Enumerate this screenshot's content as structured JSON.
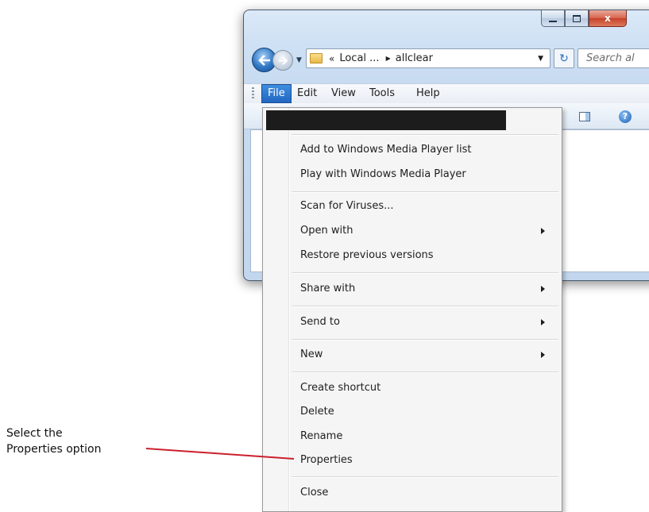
{
  "window": {
    "address": {
      "separator": "«",
      "crumb_local": "Local ...",
      "crumb_current": "allclear"
    },
    "search_placeholder": "Search al",
    "caption": {
      "close": "x"
    },
    "menubar": [
      "File",
      "Edit",
      "View",
      "Tools",
      "Help"
    ],
    "help_glyph": "?"
  },
  "file_menu": {
    "group1": [
      "Add to Windows Media Player list",
      "Play with Windows Media Player"
    ],
    "group2": [
      "Scan for Viruses...",
      "Open with",
      "Restore previous versions"
    ],
    "share_with": "Share with",
    "send_to": "Send to",
    "new": "New",
    "group3": [
      "Create shortcut",
      "Delete",
      "Rename",
      "Properties"
    ],
    "close": "Close"
  },
  "annotation": {
    "line1": "Select the",
    "line2": "Properties option"
  },
  "colors": {
    "callout": "#cc1f2d",
    "selected_menu": "#2f78d0"
  }
}
